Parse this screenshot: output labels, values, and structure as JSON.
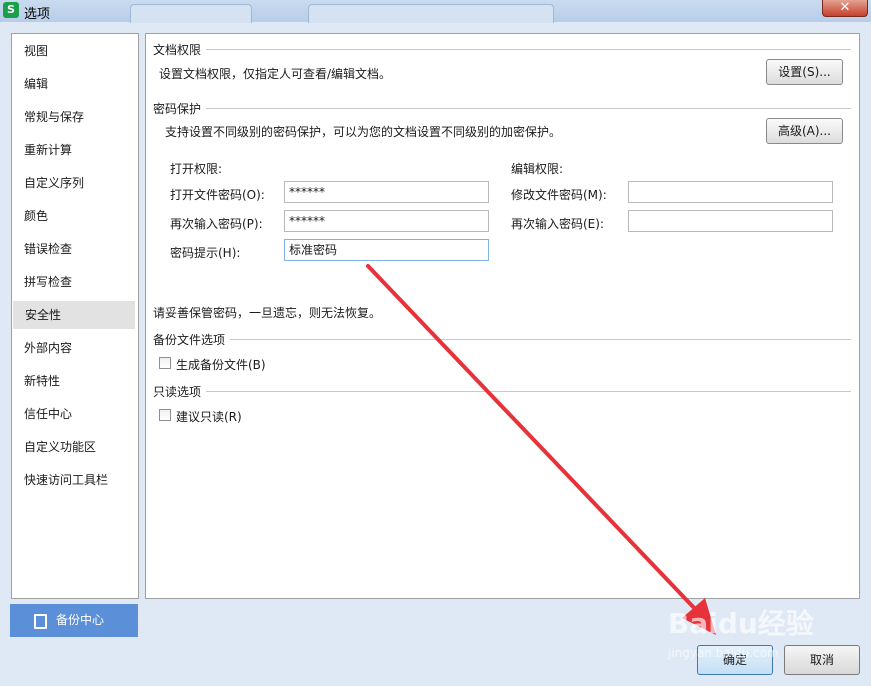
{
  "window": {
    "title": "选项",
    "app_icon_letter": "S",
    "close_glyph": "✕"
  },
  "sidebar": {
    "items": [
      {
        "label": "视图"
      },
      {
        "label": "编辑"
      },
      {
        "label": "常规与保存"
      },
      {
        "label": "重新计算"
      },
      {
        "label": "自定义序列"
      },
      {
        "label": "颜色"
      },
      {
        "label": "错误检查"
      },
      {
        "label": "拼写检查"
      },
      {
        "label": "安全性",
        "active": true
      },
      {
        "label": "外部内容"
      },
      {
        "label": "新特性"
      },
      {
        "label": "信任中心"
      },
      {
        "label": "自定义功能区"
      },
      {
        "label": "快速访问工具栏"
      }
    ],
    "backup_center_label": "备份中心"
  },
  "doc_permission": {
    "title": "文档权限",
    "desc": "设置文档权限，仅指定人可查看/编辑文档。",
    "settings_button": "设置(S)..."
  },
  "password_protection": {
    "title": "密码保护",
    "desc": "支持设置不同级别的密码保护，可以为您的文档设置不同级别的加密保护。",
    "advanced_button": "高级(A)...",
    "open_section": {
      "heading": "打开权限:",
      "open_password_label": "打开文件密码(O):",
      "open_password_value": "******",
      "reenter_label": "再次输入密码(P):",
      "reenter_value": "******",
      "hint_label": "密码提示(H):",
      "hint_value": "标准密码"
    },
    "edit_section": {
      "heading": "编辑权限:",
      "modify_password_label": "修改文件密码(M):",
      "modify_password_value": "",
      "reenter_label": "再次输入密码(E):",
      "reenter_value": ""
    },
    "warning": "请妥善保管密码，一旦遗忘，则无法恢复。"
  },
  "backup_options": {
    "title": "备份文件选项",
    "create_backup_label": "生成备份文件(B)",
    "create_backup_checked": false
  },
  "readonly_options": {
    "title": "只读选项",
    "suggest_readonly_label": "建议只读(R)",
    "suggest_readonly_checked": false
  },
  "footer": {
    "ok_button": "确定",
    "cancel_button": "取消"
  },
  "watermark": {
    "brand": "Baidu经验",
    "sub": "jingyan.baidu.com"
  },
  "colors": {
    "accent": "#5b8fd8",
    "annotation_arrow": "#e8323a"
  }
}
